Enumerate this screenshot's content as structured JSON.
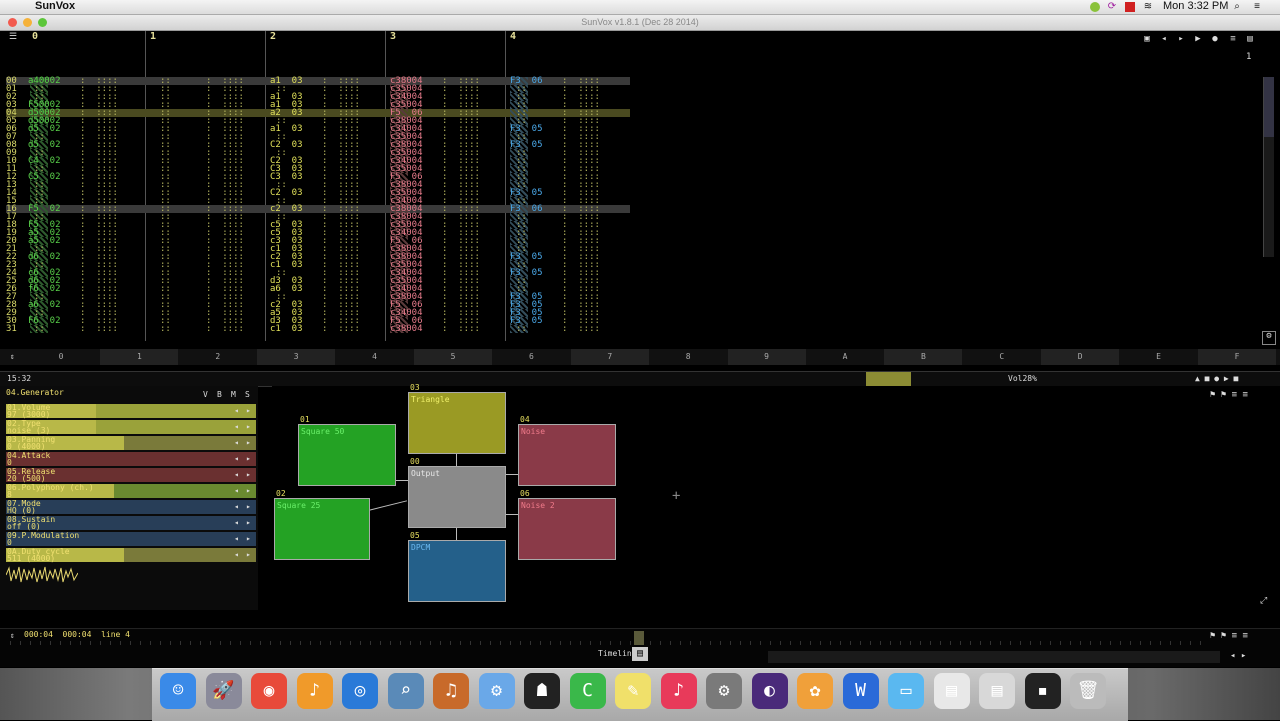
{
  "menubar": {
    "app_name": "SunVox",
    "clock": "Mon 3:32 PM"
  },
  "window": {
    "title": "SunVox v1.8.1 (Dec 28 2014)"
  },
  "pattern": {
    "tracks": [
      "0",
      "1",
      "2",
      "3",
      "4"
    ],
    "page_number": "1",
    "rows": [
      {
        "n": "00",
        "c0": "a40002",
        "c1": "",
        "c2": "a1  03",
        "c3": "c38004",
        "c4": "F3  06"
      },
      {
        "n": "01",
        "c0": "",
        "c1": "",
        "c2": "",
        "c3": "c35004",
        "c4": ""
      },
      {
        "n": "02",
        "c0": "",
        "c1": "",
        "c2": "a1  03",
        "c3": "c34004",
        "c4": ""
      },
      {
        "n": "03",
        "c0": "F50002",
        "c1": "",
        "c2": "a1  03",
        "c3": "c35004",
        "c4": ""
      },
      {
        "n": "04",
        "c0": "d50002",
        "c1": "",
        "c2": "a2  03",
        "c3": "F5  06",
        "c4": ""
      },
      {
        "n": "05",
        "c0": "d50002",
        "c1": "",
        "c2": "",
        "c3": "c38004",
        "c4": ""
      },
      {
        "n": "06",
        "c0": "d5  02",
        "c1": "",
        "c2": "a1  03",
        "c3": "c34004",
        "c4": "F3  05"
      },
      {
        "n": "07",
        "c0": "",
        "c1": "",
        "c2": "",
        "c3": "c35004",
        "c4": ""
      },
      {
        "n": "08",
        "c0": "d5  02",
        "c1": "",
        "c2": "C2  03",
        "c3": "c38004",
        "c4": "F3  05"
      },
      {
        "n": "09",
        "c0": "",
        "c1": "",
        "c2": "",
        "c3": "c35004",
        "c4": ""
      },
      {
        "n": "10",
        "c0": "C4  02",
        "c1": "",
        "c2": "C2  03",
        "c3": "c34004",
        "c4": ""
      },
      {
        "n": "11",
        "c0": "",
        "c1": "",
        "c2": "C3  03",
        "c3": "c35004",
        "c4": ""
      },
      {
        "n": "12",
        "c0": "C5  02",
        "c1": "",
        "c2": "C3  03",
        "c3": "F5  06",
        "c4": ""
      },
      {
        "n": "13",
        "c0": "",
        "c1": "",
        "c2": "",
        "c3": "c38004",
        "c4": ""
      },
      {
        "n": "14",
        "c0": "",
        "c1": "",
        "c2": "C2  03",
        "c3": "c35004",
        "c4": "F3  05"
      },
      {
        "n": "15",
        "c0": "",
        "c1": "",
        "c2": "",
        "c3": "c34004",
        "c4": ""
      },
      {
        "n": "16",
        "c0": "F5  02",
        "c1": "",
        "c2": "c2  03",
        "c3": "c38004",
        "c4": "F3  06"
      },
      {
        "n": "17",
        "c0": "",
        "c1": "",
        "c2": "",
        "c3": "c38004",
        "c4": ""
      },
      {
        "n": "18",
        "c0": "F5  02",
        "c1": "",
        "c2": "c5  03",
        "c3": "c35004",
        "c4": ""
      },
      {
        "n": "19",
        "c0": "a5  02",
        "c1": "",
        "c2": "c5  03",
        "c3": "c34004",
        "c4": ""
      },
      {
        "n": "20",
        "c0": "a5  02",
        "c1": "",
        "c2": "c3  03",
        "c3": "F5  06",
        "c4": ""
      },
      {
        "n": "21",
        "c0": "",
        "c1": "",
        "c2": "c1  03",
        "c3": "c38004",
        "c4": ""
      },
      {
        "n": "22",
        "c0": "d6  02",
        "c1": "",
        "c2": "c2  03",
        "c3": "c38004",
        "c4": "F3  05"
      },
      {
        "n": "23",
        "c0": "",
        "c1": "",
        "c2": "c1  03",
        "c3": "c35004",
        "c4": ""
      },
      {
        "n": "24",
        "c0": "c6  02",
        "c1": "",
        "c2": "",
        "c3": "c34004",
        "c4": "F3  05"
      },
      {
        "n": "25",
        "c0": "d6  02",
        "c1": "",
        "c2": "d3  03",
        "c3": "c35004",
        "c4": ""
      },
      {
        "n": "26",
        "c0": "f6  02",
        "c1": "",
        "c2": "a6  03",
        "c3": "c34004",
        "c4": ""
      },
      {
        "n": "27",
        "c0": "",
        "c1": "",
        "c2": "",
        "c3": "c38004",
        "c4": "F3  05"
      },
      {
        "n": "28",
        "c0": "a6  02",
        "c1": "",
        "c2": "c2  03",
        "c3": "F5  06",
        "c4": "F3  05"
      },
      {
        "n": "29",
        "c0": "",
        "c1": "",
        "c2": "a5  03",
        "c3": "c34004",
        "c4": "F3  05"
      },
      {
        "n": "30",
        "c0": "F6  02",
        "c1": "",
        "c2": "d3  03",
        "c3": "F5  06",
        "c4": "F3  05"
      },
      {
        "n": "31",
        "c0": "",
        "c1": "",
        "c2": "c1  03",
        "c3": "c38004",
        "c4": ""
      }
    ]
  },
  "ruler": [
    "0",
    "1",
    "2",
    "3",
    "4",
    "5",
    "6",
    "7",
    "8",
    "9",
    "A",
    "B",
    "C",
    "D",
    "E",
    "F"
  ],
  "status": {
    "time": "15:32",
    "volume": "Vol28%"
  },
  "props": {
    "title": "04.Generator",
    "flags": [
      "V",
      "B",
      "M",
      "S"
    ],
    "rows": [
      {
        "l1": "01.Volume",
        "l2": "97 (3000)",
        "fill": 0.36,
        "color": "#9aa23a"
      },
      {
        "l1": "02.Type",
        "l2": "noise (3)",
        "fill": 0.36,
        "color": "#9aa23a"
      },
      {
        "l1": "03.Panning",
        "l2": "0 (4000)",
        "fill": 0.47,
        "color": "#7a7a3a"
      },
      {
        "l1": "04.Attack",
        "l2": "0",
        "fill": 0,
        "color": "#6a3030"
      },
      {
        "l1": "05.Release",
        "l2": "20 (500)",
        "fill": 0,
        "color": "#6a3030"
      },
      {
        "l1": "06.Polyphony (ch.)",
        "l2": "8",
        "fill": 0.43,
        "color": "#6a8a30"
      },
      {
        "l1": "07.Mode",
        "l2": "HQ (0)",
        "fill": 0,
        "color": "#283e58"
      },
      {
        "l1": "08.Sustain",
        "l2": "off (0)",
        "fill": 0,
        "color": "#283e58"
      },
      {
        "l1": "09.P.Modulation",
        "l2": "0",
        "fill": 0,
        "color": "#283e58"
      },
      {
        "l1": "0A.Duty cycle",
        "l2": "511 (4000)",
        "fill": 0.47,
        "color": "#7a7a3a"
      }
    ]
  },
  "modules": [
    {
      "id": "01",
      "name": "Square 50",
      "color": "#24a224",
      "text": "#6af06a"
    },
    {
      "id": "02",
      "name": "Square 25",
      "color": "#24a224",
      "text": "#6af06a"
    },
    {
      "id": "03",
      "name": "Triangle",
      "color": "#9a9a24",
      "text": "#f0f06a"
    },
    {
      "id": "04",
      "name": "Noise",
      "color": "#8a3a48",
      "text": "#f07a8a"
    },
    {
      "id": "05",
      "name": "DPCM",
      "color": "#24608a",
      "text": "#6ab8f0"
    },
    {
      "id": "06",
      "name": "Noise 2",
      "color": "#8a3a48",
      "text": "#f07a8a"
    },
    {
      "id": "00",
      "name": "Output",
      "color": "#8a8a8a",
      "text": "#e8e8e8"
    }
  ],
  "timeline": {
    "position": "000:04  000:04  line 4",
    "label": "Timeline"
  },
  "dock": [
    "finder-icon",
    "launchpad-icon",
    "chrome-icon",
    "garageband-icon",
    "safari-icon",
    "preview-icon",
    "guitar-icon",
    "utility-icon",
    "sunvox-icon",
    "camtasia-icon",
    "notes-icon",
    "itunes-icon",
    "system-prefs-icon",
    "pro-tools-icon",
    "photos-icon",
    "word-icon",
    "folder-icon",
    "document-icon",
    "document-icon-2",
    "terminal-icon",
    "trash-icon"
  ]
}
